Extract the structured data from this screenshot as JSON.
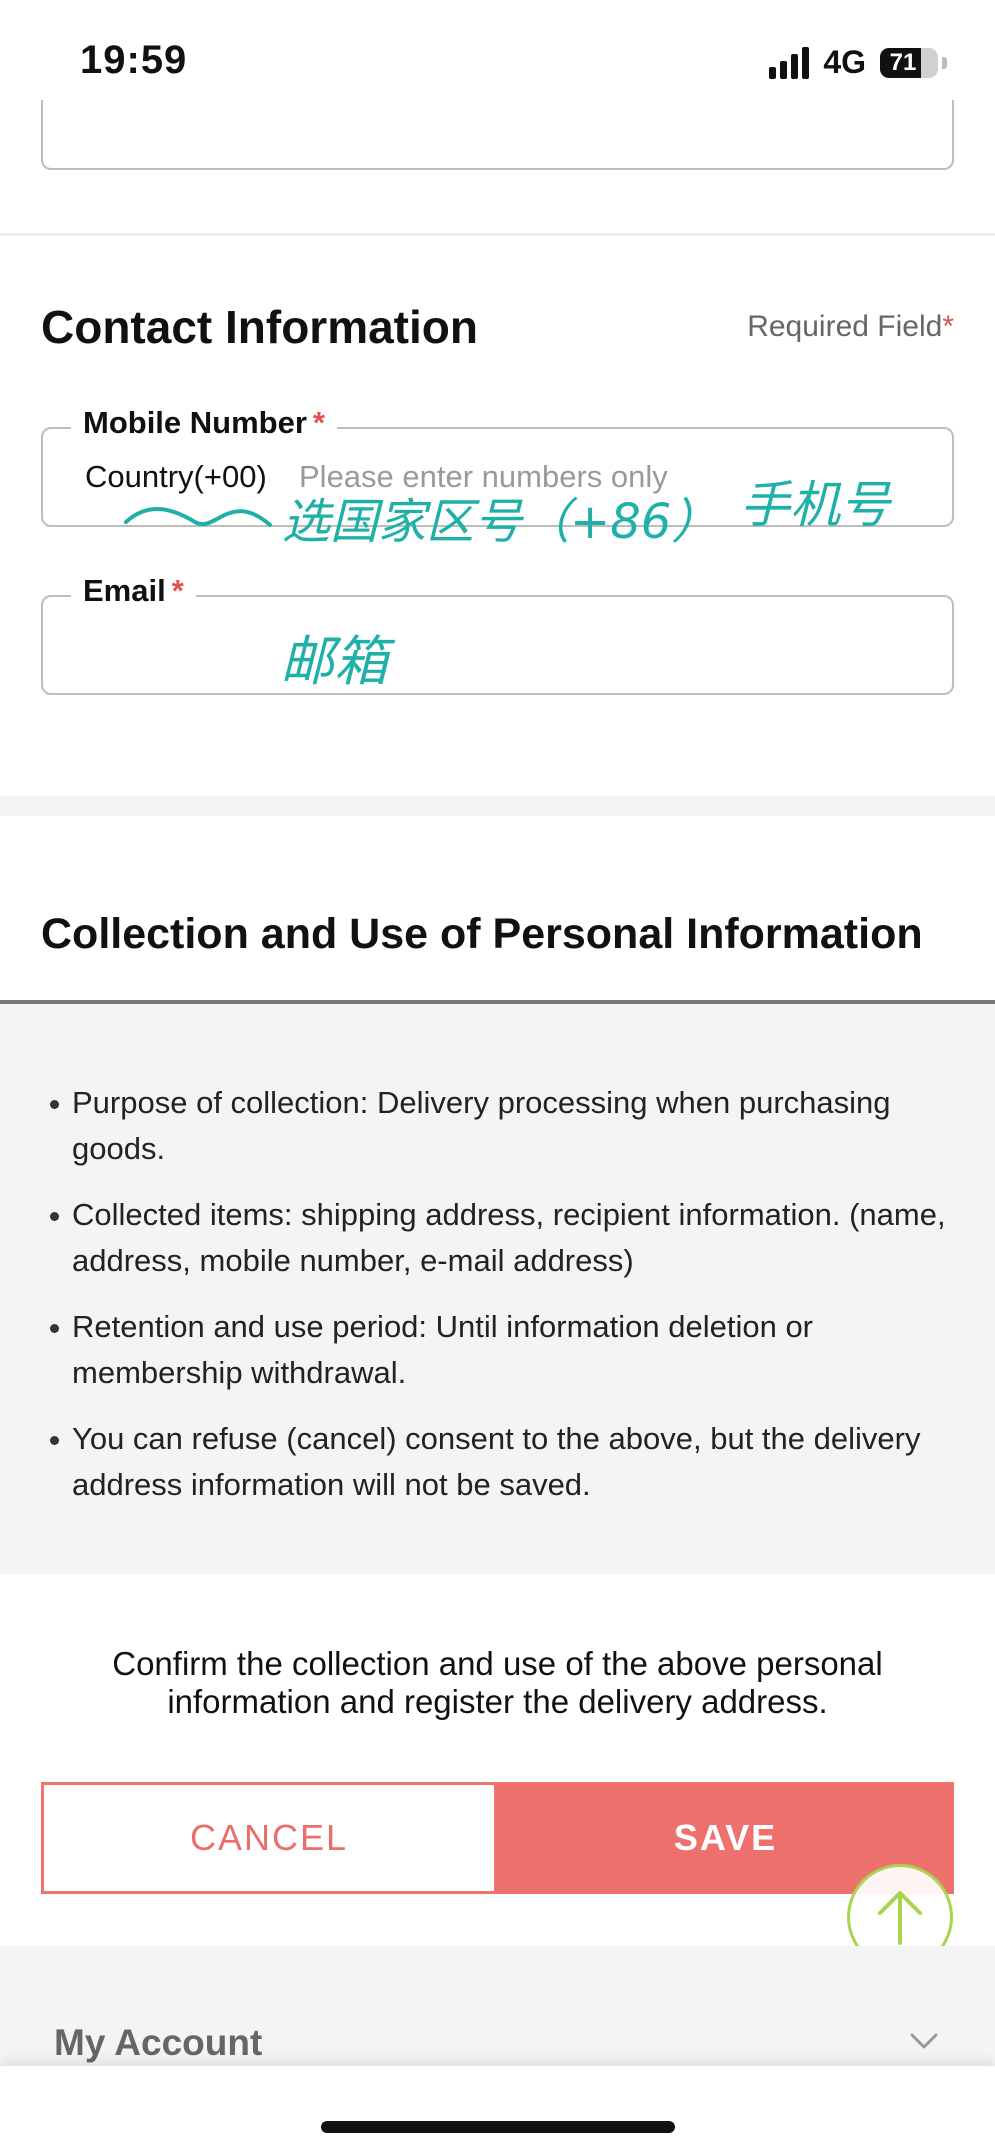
{
  "status_bar": {
    "time": "19:59",
    "network": "4G",
    "battery_text": "71",
    "battery_level_percent": 71
  },
  "contact": {
    "title": "Contact Information",
    "required_note": "Required Field",
    "required_marker": "*",
    "mobile": {
      "label": "Mobile Number",
      "country": "Country(+00)",
      "placeholder": "Please enter numbers only"
    },
    "email": {
      "label": "Email",
      "value": ""
    }
  },
  "handwriting": {
    "country_note": "选国家区号（+86）",
    "phone_note": "手机号",
    "email_note": "邮箱",
    "color": "#1fb0a8"
  },
  "consent": {
    "title": "Collection and Use of Personal Information",
    "items": [
      "Purpose of collection: Delivery processing when purchasing goods.",
      "Collected items: shipping address, recipient information. (name, address, mobile number, e-mail address)",
      "Retention and use period: Until information deletion or membership withdrawal.",
      "You can refuse (cancel) consent to the above, but the delivery address information will not be saved."
    ],
    "confirm": "Confirm the collection and use of the above personal information and register the delivery address."
  },
  "actions": {
    "cancel": "CANCEL",
    "save": "SAVE"
  },
  "footer": {
    "my_account": "My Account"
  },
  "colors": {
    "accent": "#ef716d",
    "required": "#e05050",
    "scroll_top_ring": "#a8d44e"
  },
  "icons": {
    "signal": "signal-icon",
    "battery": "battery-icon",
    "scroll_top": "arrow-up-icon",
    "footer_toggle": "chevron-down-icon"
  }
}
